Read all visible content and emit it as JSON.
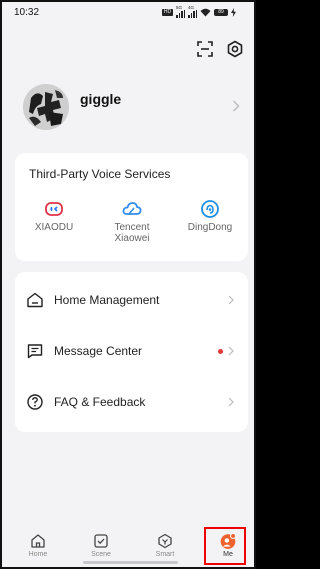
{
  "status_bar": {
    "time": "10:32",
    "network_1": "5G",
    "network_2": "4G",
    "battery": "89"
  },
  "profile": {
    "username": "giggle"
  },
  "voice_services": {
    "title": "Third-Party Voice Services",
    "items": [
      {
        "label": "XIAODU",
        "icon": "xiaodu-icon",
        "color": "#e0344a"
      },
      {
        "label": "Tencent Xiaowei",
        "icon": "tencent-xiaowei-icon",
        "color": "#2f8cf0"
      },
      {
        "label": "DingDong",
        "icon": "dingdong-icon",
        "color": "#1e8fe6"
      }
    ]
  },
  "menu": {
    "items": [
      {
        "label": "Home Management",
        "icon": "home-icon",
        "has_dot": false
      },
      {
        "label": "Message Center",
        "icon": "message-icon",
        "has_dot": true
      },
      {
        "label": "FAQ & Feedback",
        "icon": "help-icon",
        "has_dot": false
      }
    ]
  },
  "bottom_nav": {
    "items": [
      {
        "label": "Home",
        "icon": "home-tab-icon"
      },
      {
        "label": "Scene",
        "icon": "scene-tab-icon"
      },
      {
        "label": "Smart",
        "icon": "smart-tab-icon"
      },
      {
        "label": "Me",
        "icon": "me-tab-icon",
        "active": true
      }
    ]
  },
  "colors": {
    "accent": "#f0622d",
    "highlight_box": "#e00000",
    "background": "#f3f3f5"
  }
}
